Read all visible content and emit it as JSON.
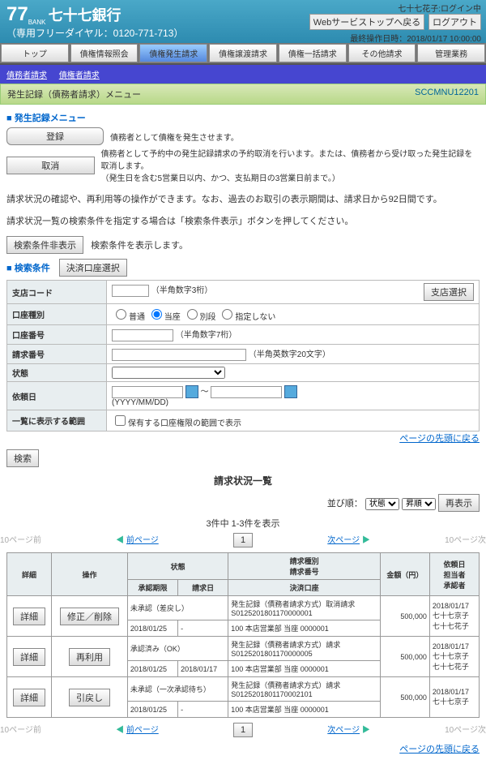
{
  "header": {
    "bank77": "77",
    "bankEn": "BANK",
    "bankName": "七十七銀行",
    "dial": "（専用フリーダイヤル：0120-771-713）",
    "userLine": "七十七花子:ログイン中",
    "btnBack": "Webサービストップへ戻る",
    "btnLogout": "ログアウト",
    "lastOp": "最終操作日時：2018/01/17 10:00:00"
  },
  "nav": [
    "トップ",
    "債権情報照会",
    "債権発生請求",
    "債権譲渡請求",
    "債権一括請求",
    "その他請求",
    "管理業務"
  ],
  "sub": [
    "債務者請求",
    "債権者請求"
  ],
  "menu": {
    "title": "発生記録（債務者請求）メニュー",
    "code": "SCCMNU12201"
  },
  "rec": {
    "hdr": "発生記録メニュー",
    "btnReg": "登録",
    "regDesc": "債務者として債権を発生させます。",
    "btnCancel": "取消",
    "cancelDesc1": "債務者として予約中の発生記録請求の予約取消を行います。または、債務者から受け取った発生記録を取消します。",
    "cancelDesc2": "（発生日を含む5営業日以内、かつ、支払期日の3営業日前まで。）"
  },
  "notes": {
    "l1": "請求状況の確認や、再利用等の操作ができます。なお、過去のお取引の表示期間は、請求日から92日間です。",
    "l2": "請求状況一覧の検索条件を指定する場合は「検索条件表示」ボタンを押してください。",
    "btn": "検索条件非表示",
    "btnDesc": "検索条件を表示します。"
  },
  "cond": {
    "hdr": "検索条件",
    "btnAcc": "決済口座選択",
    "branch": "支店コード",
    "branchHint": "（半角数字3桁）",
    "btnBranch": "支店選択",
    "acctType": "口座種別",
    "r1": "普通",
    "r2": "当座",
    "r3": "別段",
    "r4": "指定しない",
    "acctNo": "口座番号",
    "acctNoHint": "（半角数字7桁）",
    "reqNo": "請求番号",
    "reqNoHint": "（半角英数字20文字）",
    "status": "状態",
    "reqDate": "依頼日",
    "dateHint": "(YYYY/MM/DD)",
    "range": "一覧に表示する範囲",
    "chk": "保有する口座権限の範囲で表示"
  },
  "search": "検索",
  "topLink": "ページの先頭に戻る",
  "list": {
    "title": "請求状況一覧",
    "sort": "並び順：",
    "sortOpt1": "状態",
    "sortOpt2": "昇順",
    "btnRe": "再表示",
    "count": "3件中 1-3件を表示",
    "pgNum": "1",
    "p10b": "10ページ前",
    "pPrev": "前ページ",
    "pNext": "次ページ",
    "p10n": "10ページ次"
  },
  "th": {
    "detail": "詳細",
    "op": "操作",
    "status": "状態",
    "reqTypeNo": "請求種別\n請求番号",
    "amt": "金額（円）",
    "reqDate": "依頼日\n担当者\n承認者",
    "apprLimit": "承認期限",
    "reqD": "請求日",
    "acct": "決済口座"
  },
  "rows": [
    {
      "d": "詳細",
      "op": "修正／削除",
      "st": "未承認（差戻し）",
      "tp": "発生記録（債務者請求方式）取消請求",
      "no": "S0125201801170000001",
      "amt": "500,000",
      "dt": "2018/01/17",
      "p1": "七十七京子",
      "p2": "七十七花子",
      "lim": "2018/01/25",
      "rd": "-",
      "ac": "100 本店営業部 当座 0000001"
    },
    {
      "d": "詳細",
      "op": "再利用",
      "st": "承認済み（OK）",
      "tp": "発生記録（債務者請求方式）請求",
      "no": "S0125201801170000005",
      "amt": "500,000",
      "dt": "2018/01/17",
      "p1": "七十七京子",
      "p2": "七十七花子",
      "lim": "2018/01/25",
      "rd": "2018/01/17",
      "ac": "100 本店営業部 当座 0000001"
    },
    {
      "d": "詳細",
      "op": "引戻し",
      "st": "未承認（一次承認待ち）",
      "tp": "発生記録（債務者請求方式）請求",
      "no": "S0125201801170002101",
      "amt": "500,000",
      "dt": "2018/01/17",
      "p1": "七十七京子",
      "p2": "",
      "lim": "2018/01/25",
      "rd": "-",
      "ac": "100 本店営業部 当座 0000001"
    }
  ]
}
